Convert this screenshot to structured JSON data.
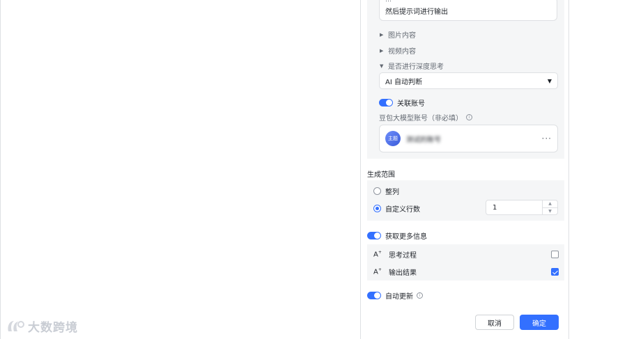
{
  "prompt_box": {
    "line1": "…",
    "line2": "然后提示词进行输出"
  },
  "collapses": [
    {
      "label": "图片内容",
      "expanded": false
    },
    {
      "label": "视频内容",
      "expanded": false
    },
    {
      "label": "是否进行深度思考",
      "expanded": true
    }
  ],
  "deep_think_select": {
    "value": "AI 自动判断"
  },
  "link_account": {
    "label": "关联账号",
    "on": true
  },
  "account": {
    "field_label": "豆包大模型账号（非必填）",
    "avatar_text": "主题",
    "name": "测试的账号",
    "more": "···"
  },
  "range": {
    "title": "生成范围",
    "options": [
      {
        "label": "整列",
        "selected": false
      },
      {
        "label": "自定义行数",
        "selected": true
      }
    ],
    "row_count": "1"
  },
  "more_info": {
    "label": "获取更多信息",
    "on": true,
    "items": [
      {
        "label": "思考过程",
        "checked": false
      },
      {
        "label": "输出结果",
        "checked": true
      }
    ]
  },
  "auto_update": {
    "label": "自动更新",
    "on": true
  },
  "footer": {
    "cancel": "取消",
    "ok": "确定"
  },
  "watermark": {
    "text": "大数跨境"
  },
  "colors": {
    "accent": "#3370ff",
    "grey_bg": "#f5f6f7",
    "border": "#dee0e3"
  }
}
